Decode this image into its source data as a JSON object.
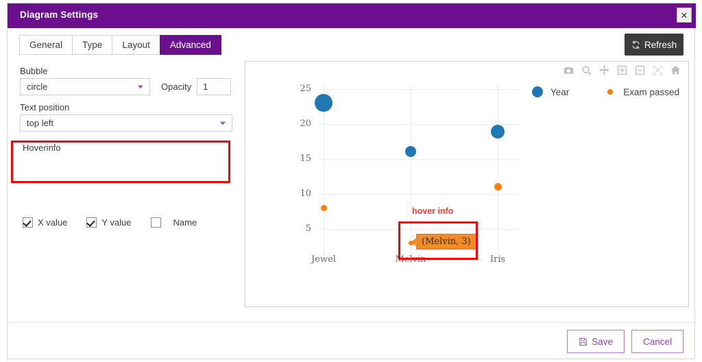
{
  "window": {
    "title": "Diagram Settings",
    "close_label": "✕"
  },
  "tabs": [
    {
      "label": "General",
      "active": false
    },
    {
      "label": "Type",
      "active": false
    },
    {
      "label": "Layout",
      "active": false
    },
    {
      "label": "Advanced",
      "active": true
    }
  ],
  "toolbar": {
    "refresh_label": "Refresh",
    "refresh_icon": "refresh-icon"
  },
  "settings": {
    "bubble_label": "Bubble",
    "bubble_value": "circle",
    "opacity_label": "Opacity",
    "opacity_value": "1",
    "text_position_label": "Text position",
    "text_position_value": "top left",
    "hoverinfo_label": "Hoverinfo",
    "hoverinfo_options": [
      {
        "label": "X value",
        "checked": true
      },
      {
        "label": "Y value",
        "checked": true
      },
      {
        "label": "Name",
        "checked": false
      }
    ]
  },
  "plot_toolbar": [
    {
      "name": "camera-icon",
      "title": "Download plot as a png"
    },
    {
      "name": "zoom-magnifier-icon",
      "title": "Zoom"
    },
    {
      "name": "pan-move-icon",
      "title": "Pan"
    },
    {
      "name": "zoom-in-icon",
      "title": "Zoom in"
    },
    {
      "name": "zoom-out-icon",
      "title": "Zoom out"
    },
    {
      "name": "autoscale-icon",
      "title": "Autoscale"
    },
    {
      "name": "home-reset-axes-icon",
      "title": "Reset axes"
    }
  ],
  "annotations": {
    "hover_info_label": "hover info",
    "tooltip_text": "(Melvin, 3)"
  },
  "footer": {
    "save_label": "Save",
    "cancel_label": "Cancel",
    "save_icon": "floppy-disk-icon"
  },
  "colors": {
    "titlebar": "#6b0f8f",
    "accent_purple": "#8e44ad",
    "series_blue": "#1f77b4",
    "series_orange": "#ff7f0e",
    "tooltip_orange": "#f08b28",
    "highlight_red": "#ff0000",
    "annotation_red": "#ff3b30"
  },
  "chart_data": {
    "type": "scatter",
    "title": "",
    "xlabel": "",
    "ylabel": "",
    "categories": [
      "Jewel",
      "Melvin",
      "Iris"
    ],
    "yticks": [
      5,
      10,
      15,
      20,
      25
    ],
    "ylim": [
      2,
      27
    ],
    "grid": true,
    "legend_position": "top-right",
    "series": [
      {
        "name": "Year",
        "color": "#1f77b4",
        "marker": "circle",
        "values": [
          23,
          16,
          19
        ],
        "sizes": [
          26,
          16,
          20
        ]
      },
      {
        "name": "Exam passed",
        "color": "#ff7f0e",
        "marker": "circle",
        "values": [
          8,
          3,
          11
        ],
        "sizes": [
          9,
          7,
          11
        ]
      }
    ],
    "hover_point": {
      "category": "Melvin",
      "series": "Exam passed",
      "value": 3,
      "label": "(Melvin, 3)"
    }
  }
}
